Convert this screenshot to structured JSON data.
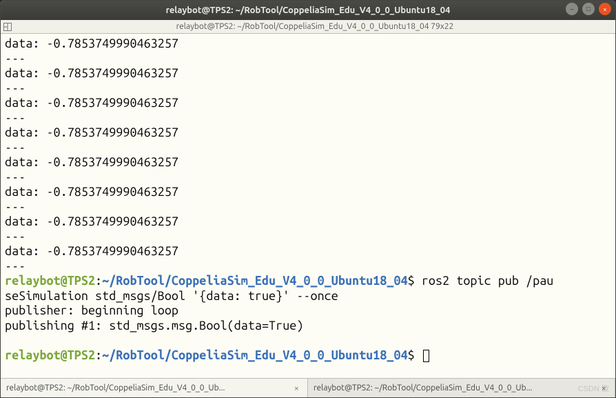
{
  "window": {
    "title": "relaybot@TPS2: ~/RobTool/CoppeliaSim_Edu_V4_0_0_Ubuntu18_04",
    "subtitle": "relaybot@TPS2: ~/RobTool/CoppeliaSim_Edu_V4_0_0_Ubuntu18_04 79x22"
  },
  "prompt": {
    "user_host": "relaybot@TPS2",
    "colon": ":",
    "path": "~/RobTool/CoppeliaSim_Edu_V4_0_0_Ubuntu18_04",
    "sigil": "$ "
  },
  "data_entries": [
    {
      "label": "data: ",
      "value": "-0.7853749990463257",
      "sep": "---"
    },
    {
      "label": "data: ",
      "value": "-0.7853749990463257",
      "sep": "---"
    },
    {
      "label": "data: ",
      "value": "-0.7853749990463257",
      "sep": "---"
    },
    {
      "label": "data: ",
      "value": "-0.7853749990463257",
      "sep": "---"
    },
    {
      "label": "data: ",
      "value": "-0.7853749990463257",
      "sep": "---"
    },
    {
      "label": "data: ",
      "value": "-0.7853749990463257",
      "sep": "---"
    },
    {
      "label": "data: ",
      "value": "-0.7853749990463257",
      "sep": "---"
    },
    {
      "label": "data: ",
      "value": "-0.7853749990463257",
      "sep": "---"
    }
  ],
  "cmd1": {
    "line1_tail": "ros2 topic pub /pau",
    "line2": "seSimulation std_msgs/Bool '{data: true}' --once",
    "out1": "publisher: beginning loop",
    "out2": "publishing #1: std_msgs.msg.Bool(data=True)"
  },
  "tabs": [
    {
      "label": "relaybot@TPS2: ~/RobTool/CoppeliaSim_Edu_V4_0_0_Ub...",
      "active": true
    },
    {
      "label": "relaybot@TPS2: ~/RobTool/CoppeliaSim_Edu_V4_0_0_Ub...",
      "active": false
    }
  ],
  "watermark": "CSDN 数"
}
